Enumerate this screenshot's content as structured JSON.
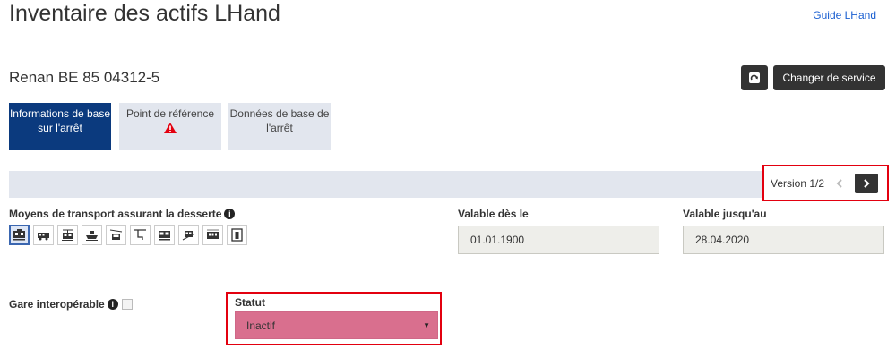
{
  "header": {
    "title": "Inventaire des actifs LHand",
    "guide_link": "Guide LHand"
  },
  "stop": {
    "name": "Renan BE 85 04312-5"
  },
  "toolbar": {
    "change_label": "Changer de service",
    "refresh_icon": "external-refresh-icon"
  },
  "tabs": [
    {
      "label": "Informations de base sur l'arrêt",
      "active": true
    },
    {
      "label": "Point de référence",
      "active": false,
      "warning": true
    },
    {
      "label": "Données de base de l'arrêt",
      "active": false
    }
  ],
  "version": {
    "label": "Version 1/2"
  },
  "transport": {
    "label": "Moyens de transport assurant la desserte",
    "icons": [
      "train-icon",
      "bus-icon",
      "tram-icon",
      "boat-icon",
      "cable-car-icon",
      "chairlift-icon",
      "cog-railway-icon",
      "funicular-icon",
      "metro-icon",
      "elevator-icon"
    ],
    "selected": 0
  },
  "valid_from": {
    "label": "Valable dès le",
    "value": "01.01.1900"
  },
  "valid_to": {
    "label": "Valable jusqu'au",
    "value": "28.04.2020"
  },
  "gare": {
    "label": "Gare interopérable",
    "checked": false
  },
  "statut": {
    "label": "Statut",
    "value": "Inactif"
  },
  "colors": {
    "active_tab": "#0b3a7e",
    "highlight": "#e3000f",
    "status_bg": "#d96f8e"
  }
}
